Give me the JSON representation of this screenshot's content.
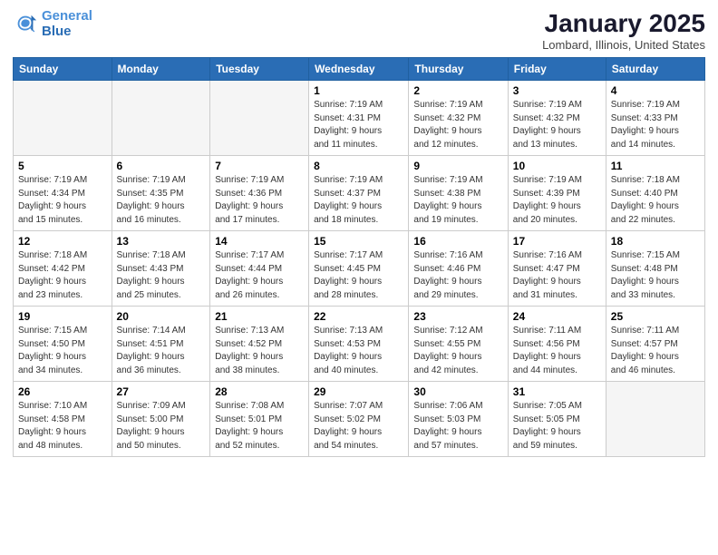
{
  "header": {
    "logo_line1": "General",
    "logo_line2": "Blue",
    "month_title": "January 2025",
    "location": "Lombard, Illinois, United States"
  },
  "days_of_week": [
    "Sunday",
    "Monday",
    "Tuesday",
    "Wednesday",
    "Thursday",
    "Friday",
    "Saturday"
  ],
  "weeks": [
    {
      "days": [
        {
          "num": "",
          "empty": true
        },
        {
          "num": "",
          "empty": true
        },
        {
          "num": "",
          "empty": true
        },
        {
          "num": "1",
          "info": "Sunrise: 7:19 AM\nSunset: 4:31 PM\nDaylight: 9 hours\nand 11 minutes."
        },
        {
          "num": "2",
          "info": "Sunrise: 7:19 AM\nSunset: 4:32 PM\nDaylight: 9 hours\nand 12 minutes."
        },
        {
          "num": "3",
          "info": "Sunrise: 7:19 AM\nSunset: 4:32 PM\nDaylight: 9 hours\nand 13 minutes."
        },
        {
          "num": "4",
          "info": "Sunrise: 7:19 AM\nSunset: 4:33 PM\nDaylight: 9 hours\nand 14 minutes."
        }
      ]
    },
    {
      "days": [
        {
          "num": "5",
          "info": "Sunrise: 7:19 AM\nSunset: 4:34 PM\nDaylight: 9 hours\nand 15 minutes."
        },
        {
          "num": "6",
          "info": "Sunrise: 7:19 AM\nSunset: 4:35 PM\nDaylight: 9 hours\nand 16 minutes."
        },
        {
          "num": "7",
          "info": "Sunrise: 7:19 AM\nSunset: 4:36 PM\nDaylight: 9 hours\nand 17 minutes."
        },
        {
          "num": "8",
          "info": "Sunrise: 7:19 AM\nSunset: 4:37 PM\nDaylight: 9 hours\nand 18 minutes."
        },
        {
          "num": "9",
          "info": "Sunrise: 7:19 AM\nSunset: 4:38 PM\nDaylight: 9 hours\nand 19 minutes."
        },
        {
          "num": "10",
          "info": "Sunrise: 7:19 AM\nSunset: 4:39 PM\nDaylight: 9 hours\nand 20 minutes."
        },
        {
          "num": "11",
          "info": "Sunrise: 7:18 AM\nSunset: 4:40 PM\nDaylight: 9 hours\nand 22 minutes."
        }
      ]
    },
    {
      "days": [
        {
          "num": "12",
          "info": "Sunrise: 7:18 AM\nSunset: 4:42 PM\nDaylight: 9 hours\nand 23 minutes."
        },
        {
          "num": "13",
          "info": "Sunrise: 7:18 AM\nSunset: 4:43 PM\nDaylight: 9 hours\nand 25 minutes."
        },
        {
          "num": "14",
          "info": "Sunrise: 7:17 AM\nSunset: 4:44 PM\nDaylight: 9 hours\nand 26 minutes."
        },
        {
          "num": "15",
          "info": "Sunrise: 7:17 AM\nSunset: 4:45 PM\nDaylight: 9 hours\nand 28 minutes."
        },
        {
          "num": "16",
          "info": "Sunrise: 7:16 AM\nSunset: 4:46 PM\nDaylight: 9 hours\nand 29 minutes."
        },
        {
          "num": "17",
          "info": "Sunrise: 7:16 AM\nSunset: 4:47 PM\nDaylight: 9 hours\nand 31 minutes."
        },
        {
          "num": "18",
          "info": "Sunrise: 7:15 AM\nSunset: 4:48 PM\nDaylight: 9 hours\nand 33 minutes."
        }
      ]
    },
    {
      "days": [
        {
          "num": "19",
          "info": "Sunrise: 7:15 AM\nSunset: 4:50 PM\nDaylight: 9 hours\nand 34 minutes."
        },
        {
          "num": "20",
          "info": "Sunrise: 7:14 AM\nSunset: 4:51 PM\nDaylight: 9 hours\nand 36 minutes."
        },
        {
          "num": "21",
          "info": "Sunrise: 7:13 AM\nSunset: 4:52 PM\nDaylight: 9 hours\nand 38 minutes."
        },
        {
          "num": "22",
          "info": "Sunrise: 7:13 AM\nSunset: 4:53 PM\nDaylight: 9 hours\nand 40 minutes."
        },
        {
          "num": "23",
          "info": "Sunrise: 7:12 AM\nSunset: 4:55 PM\nDaylight: 9 hours\nand 42 minutes."
        },
        {
          "num": "24",
          "info": "Sunrise: 7:11 AM\nSunset: 4:56 PM\nDaylight: 9 hours\nand 44 minutes."
        },
        {
          "num": "25",
          "info": "Sunrise: 7:11 AM\nSunset: 4:57 PM\nDaylight: 9 hours\nand 46 minutes."
        }
      ]
    },
    {
      "days": [
        {
          "num": "26",
          "info": "Sunrise: 7:10 AM\nSunset: 4:58 PM\nDaylight: 9 hours\nand 48 minutes."
        },
        {
          "num": "27",
          "info": "Sunrise: 7:09 AM\nSunset: 5:00 PM\nDaylight: 9 hours\nand 50 minutes."
        },
        {
          "num": "28",
          "info": "Sunrise: 7:08 AM\nSunset: 5:01 PM\nDaylight: 9 hours\nand 52 minutes."
        },
        {
          "num": "29",
          "info": "Sunrise: 7:07 AM\nSunset: 5:02 PM\nDaylight: 9 hours\nand 54 minutes."
        },
        {
          "num": "30",
          "info": "Sunrise: 7:06 AM\nSunset: 5:03 PM\nDaylight: 9 hours\nand 57 minutes."
        },
        {
          "num": "31",
          "info": "Sunrise: 7:05 AM\nSunset: 5:05 PM\nDaylight: 9 hours\nand 59 minutes."
        },
        {
          "num": "",
          "empty": true
        }
      ]
    }
  ]
}
